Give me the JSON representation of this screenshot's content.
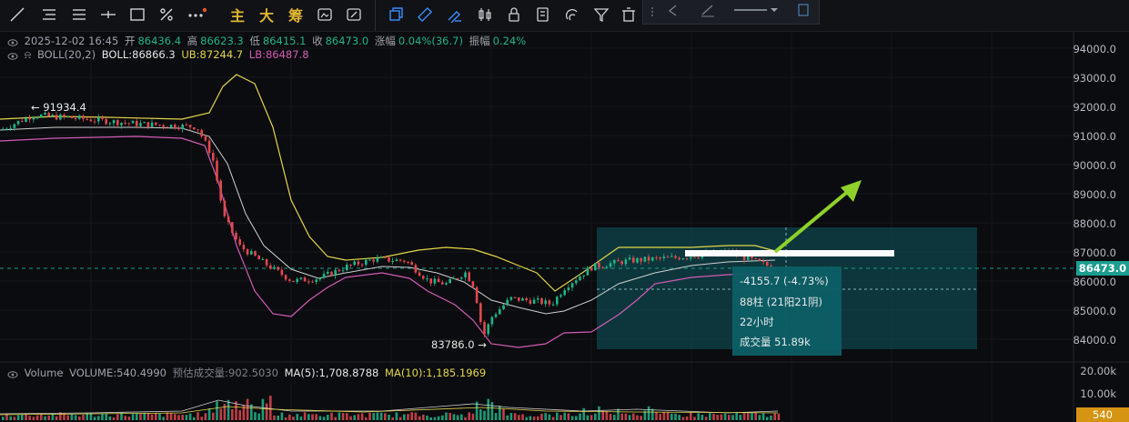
{
  "toolbar": {
    "tools": [
      "trend-line-icon",
      "horizontal-lines-icon",
      "parallel-lines-icon",
      "cross-line-icon",
      "rectangle-icon",
      "brush-icon",
      "more-icon"
    ],
    "text_tools": [
      "主",
      "大",
      "筹"
    ],
    "right_tools": [
      "indicator-icon",
      "ruler-icon",
      "measure-icon",
      "candle-icon",
      "lock-icon",
      "note-icon",
      "magnet-icon",
      "filter-icon",
      "trash-icon"
    ]
  },
  "legend": {
    "datetime": "2025-12-02 16:45",
    "open_label": "开",
    "open": "86436.4",
    "high_label": "高",
    "high": "86623.3",
    "low_label": "低",
    "low": "86415.1",
    "close_label": "收",
    "close": "86473.0",
    "change_label": "涨幅",
    "change": "0.04%(36.7)",
    "amp_label": "振幅",
    "amp": "0.24%"
  },
  "boll": {
    "name": "BOLL(20,2)",
    "boll": "BOLL:86866.3",
    "ub": "UB:87244.7",
    "lb": "LB:86487.8"
  },
  "volume_legend": {
    "name": "Volume",
    "volume": "VOLUME:540.4990",
    "est": "预估成交量:902.5030",
    "ma5": "MA(5):1,708.8788",
    "ma10": "MA(10):1,185.1969"
  },
  "price_axis": [
    "94000.0",
    "93000.0",
    "92000.0",
    "91000.0",
    "90000.0",
    "89000.0",
    "88000.0",
    "87000.0",
    "86000.0",
    "85000.0",
    "84000.0"
  ],
  "current_price": "86473.0",
  "volume_axis": [
    "20.00k",
    "10.00k"
  ],
  "current_volume": "540",
  "high_marker": "← 91934.4",
  "low_marker": "83786.0 →",
  "measure": {
    "change": "-4155.7 (-4.73%)",
    "bars": "88柱 (21阳21阴)",
    "duration": "22小时",
    "volume": "成交量 51.89k"
  },
  "colors": {
    "up": "#1fb58a",
    "down": "#e0484d",
    "ub": "#e4d64a",
    "mid": "#cfcfcf",
    "lb": "#d35bb5",
    "measure": "#0e6b73"
  }
}
